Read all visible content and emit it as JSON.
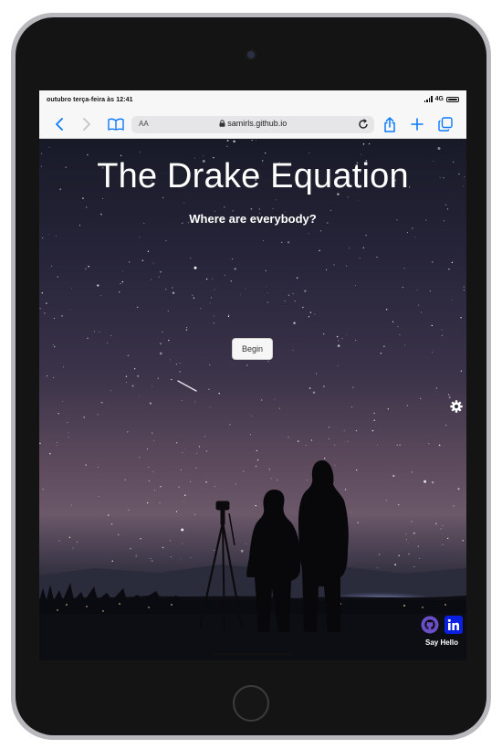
{
  "device": {
    "name": "iPad"
  },
  "status_bar": {
    "time": "outubro terça-feira às 12:41",
    "network": "4G"
  },
  "browser": {
    "url": "samirls.github.io",
    "text_size_label": "AA",
    "icons": [
      "back-icon",
      "forward-icon",
      "bookmarks-icon",
      "lock-icon",
      "reload-icon",
      "share-icon",
      "new-tab-icon",
      "tabs-icon"
    ]
  },
  "page": {
    "title": "The Drake Equation",
    "subtitle": "Where are everybody?",
    "begin_button": "Begin",
    "say_hello": "Say Hello",
    "social_icons": [
      "github-icon",
      "linkedin-icon"
    ],
    "settings_icon": "gear-icon"
  },
  "colors": {
    "safari_blue": "#0a7aff",
    "linkedin_blue": "#0a1fe0",
    "github_purple": "#6a4fc9",
    "title_text": "#ffffff"
  }
}
